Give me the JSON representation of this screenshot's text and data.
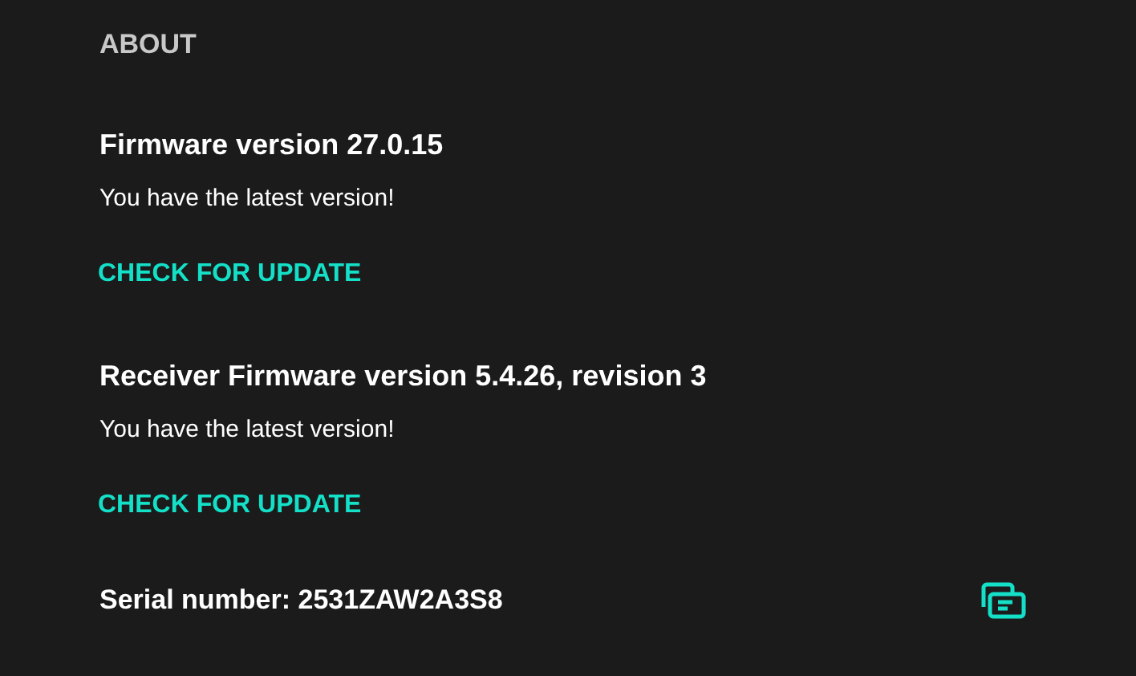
{
  "section_title": "ABOUT",
  "firmware": [
    {
      "title": "Firmware version 27.0.15",
      "status": "You have the latest version!",
      "action": "CHECK FOR UPDATE"
    },
    {
      "title": "Receiver Firmware version 5.4.26, revision 3",
      "status": "You have the latest version!",
      "action": "CHECK FOR UPDATE"
    }
  ],
  "serial": {
    "label": "Serial number: 2531ZAW2A3S8"
  }
}
